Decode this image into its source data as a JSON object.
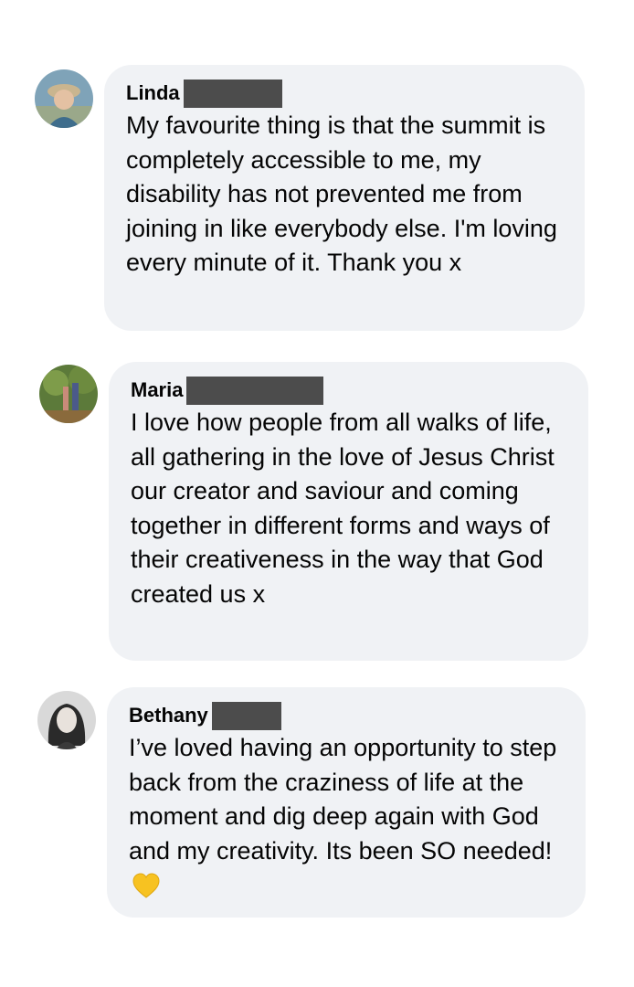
{
  "comments": [
    {
      "name": "Linda",
      "text": "My favourite thing is that the summit is completely accessible to me, my disability has not prevented me from joining in like everybody else. I'm loving every minute of it. Thank you x",
      "avatar": "linda-avatar",
      "name_redacted": true
    },
    {
      "name": "Maria",
      "text": "I love how people from all walks of life, all gathering in the love of Jesus Christ our creator and saviour and coming together in different forms and ways of their creativeness in the way that God created us x",
      "avatar": "maria-avatar",
      "name_redacted": true
    },
    {
      "name": "Bethany",
      "text": "I’ve loved having an opportunity to step back from the craziness of life at the moment and dig deep again with God and my creativity. Its been SO needed!",
      "emoji": "yellow-heart-icon",
      "avatar": "bethany-avatar",
      "name_redacted": true
    }
  ],
  "colors": {
    "bubble": "#f0f2f5",
    "redaction": "#4c4c4c",
    "text": "#050505",
    "heart": "#f7c221"
  }
}
